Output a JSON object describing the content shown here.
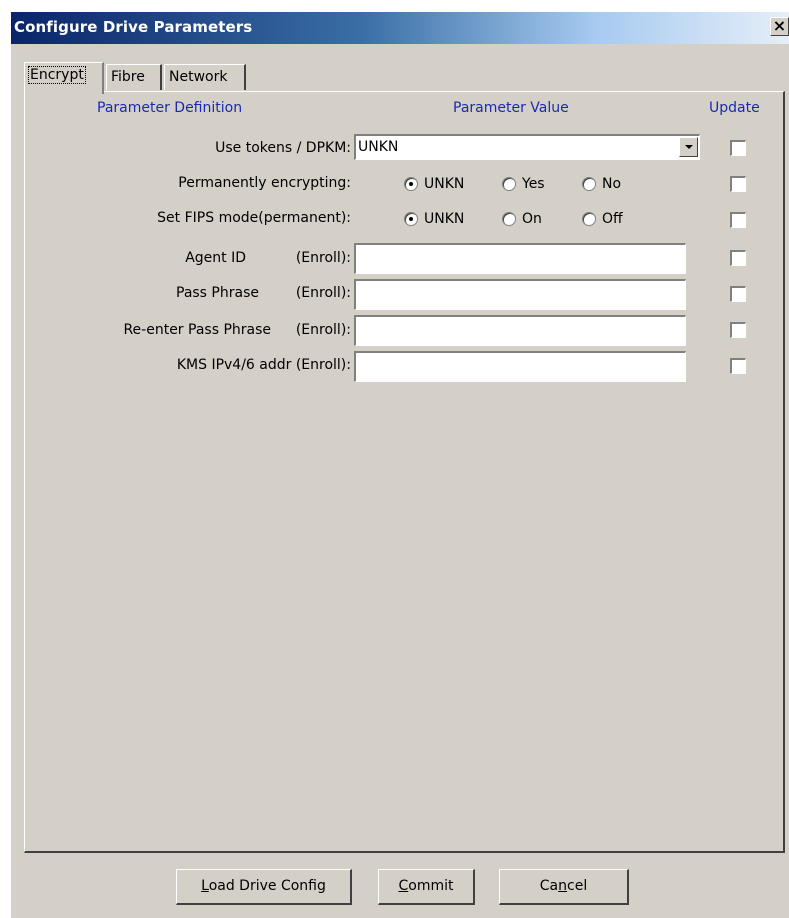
{
  "window": {
    "title": "Configure Drive Parameters",
    "close_glyph": "×"
  },
  "tabs": [
    {
      "label": "Encrypt",
      "active": true
    },
    {
      "label": "Fibre",
      "active": false
    },
    {
      "label": "Network",
      "active": false
    }
  ],
  "headers": {
    "definition": "Parameter Definition",
    "value": "Parameter Value",
    "update": "Update"
  },
  "rows": {
    "tokens": {
      "label": "Use tokens / DPKM:",
      "value": "UNKN",
      "update": false
    },
    "perm_encrypt": {
      "label": "Permanently encrypting:",
      "options": [
        "UNKN",
        "Yes",
        "No"
      ],
      "selected": "UNKN",
      "update": false
    },
    "fips": {
      "label": "Set FIPS mode(permanent):",
      "options": [
        "UNKN",
        "On",
        "Off"
      ],
      "selected": "UNKN",
      "update": false
    },
    "agent_id": {
      "label": "Agent ID",
      "suffix": "(Enroll):",
      "value": "",
      "update": false
    },
    "pass_phrase": {
      "label": "Pass Phrase",
      "suffix": "(Enroll):",
      "value": "",
      "update": false
    },
    "reenter_pass": {
      "label": "Re-enter Pass Phrase",
      "suffix": "(Enroll):",
      "value": "",
      "update": false
    },
    "kms_addr": {
      "label": "KMS IPv4/6 addr (Enroll):",
      "value": "",
      "update": false
    }
  },
  "buttons": {
    "load": {
      "mnemonic": "L",
      "rest": "oad Drive Config"
    },
    "commit": {
      "mnemonic": "C",
      "rest": "ommit"
    },
    "cancel": {
      "pre": "Ca",
      "mnemonic": "n",
      "rest": "cel"
    }
  },
  "colors": {
    "titlebar_start": "#0a246a",
    "header_text": "#1a2ab0",
    "dialog_face": "#d4d0c8"
  }
}
